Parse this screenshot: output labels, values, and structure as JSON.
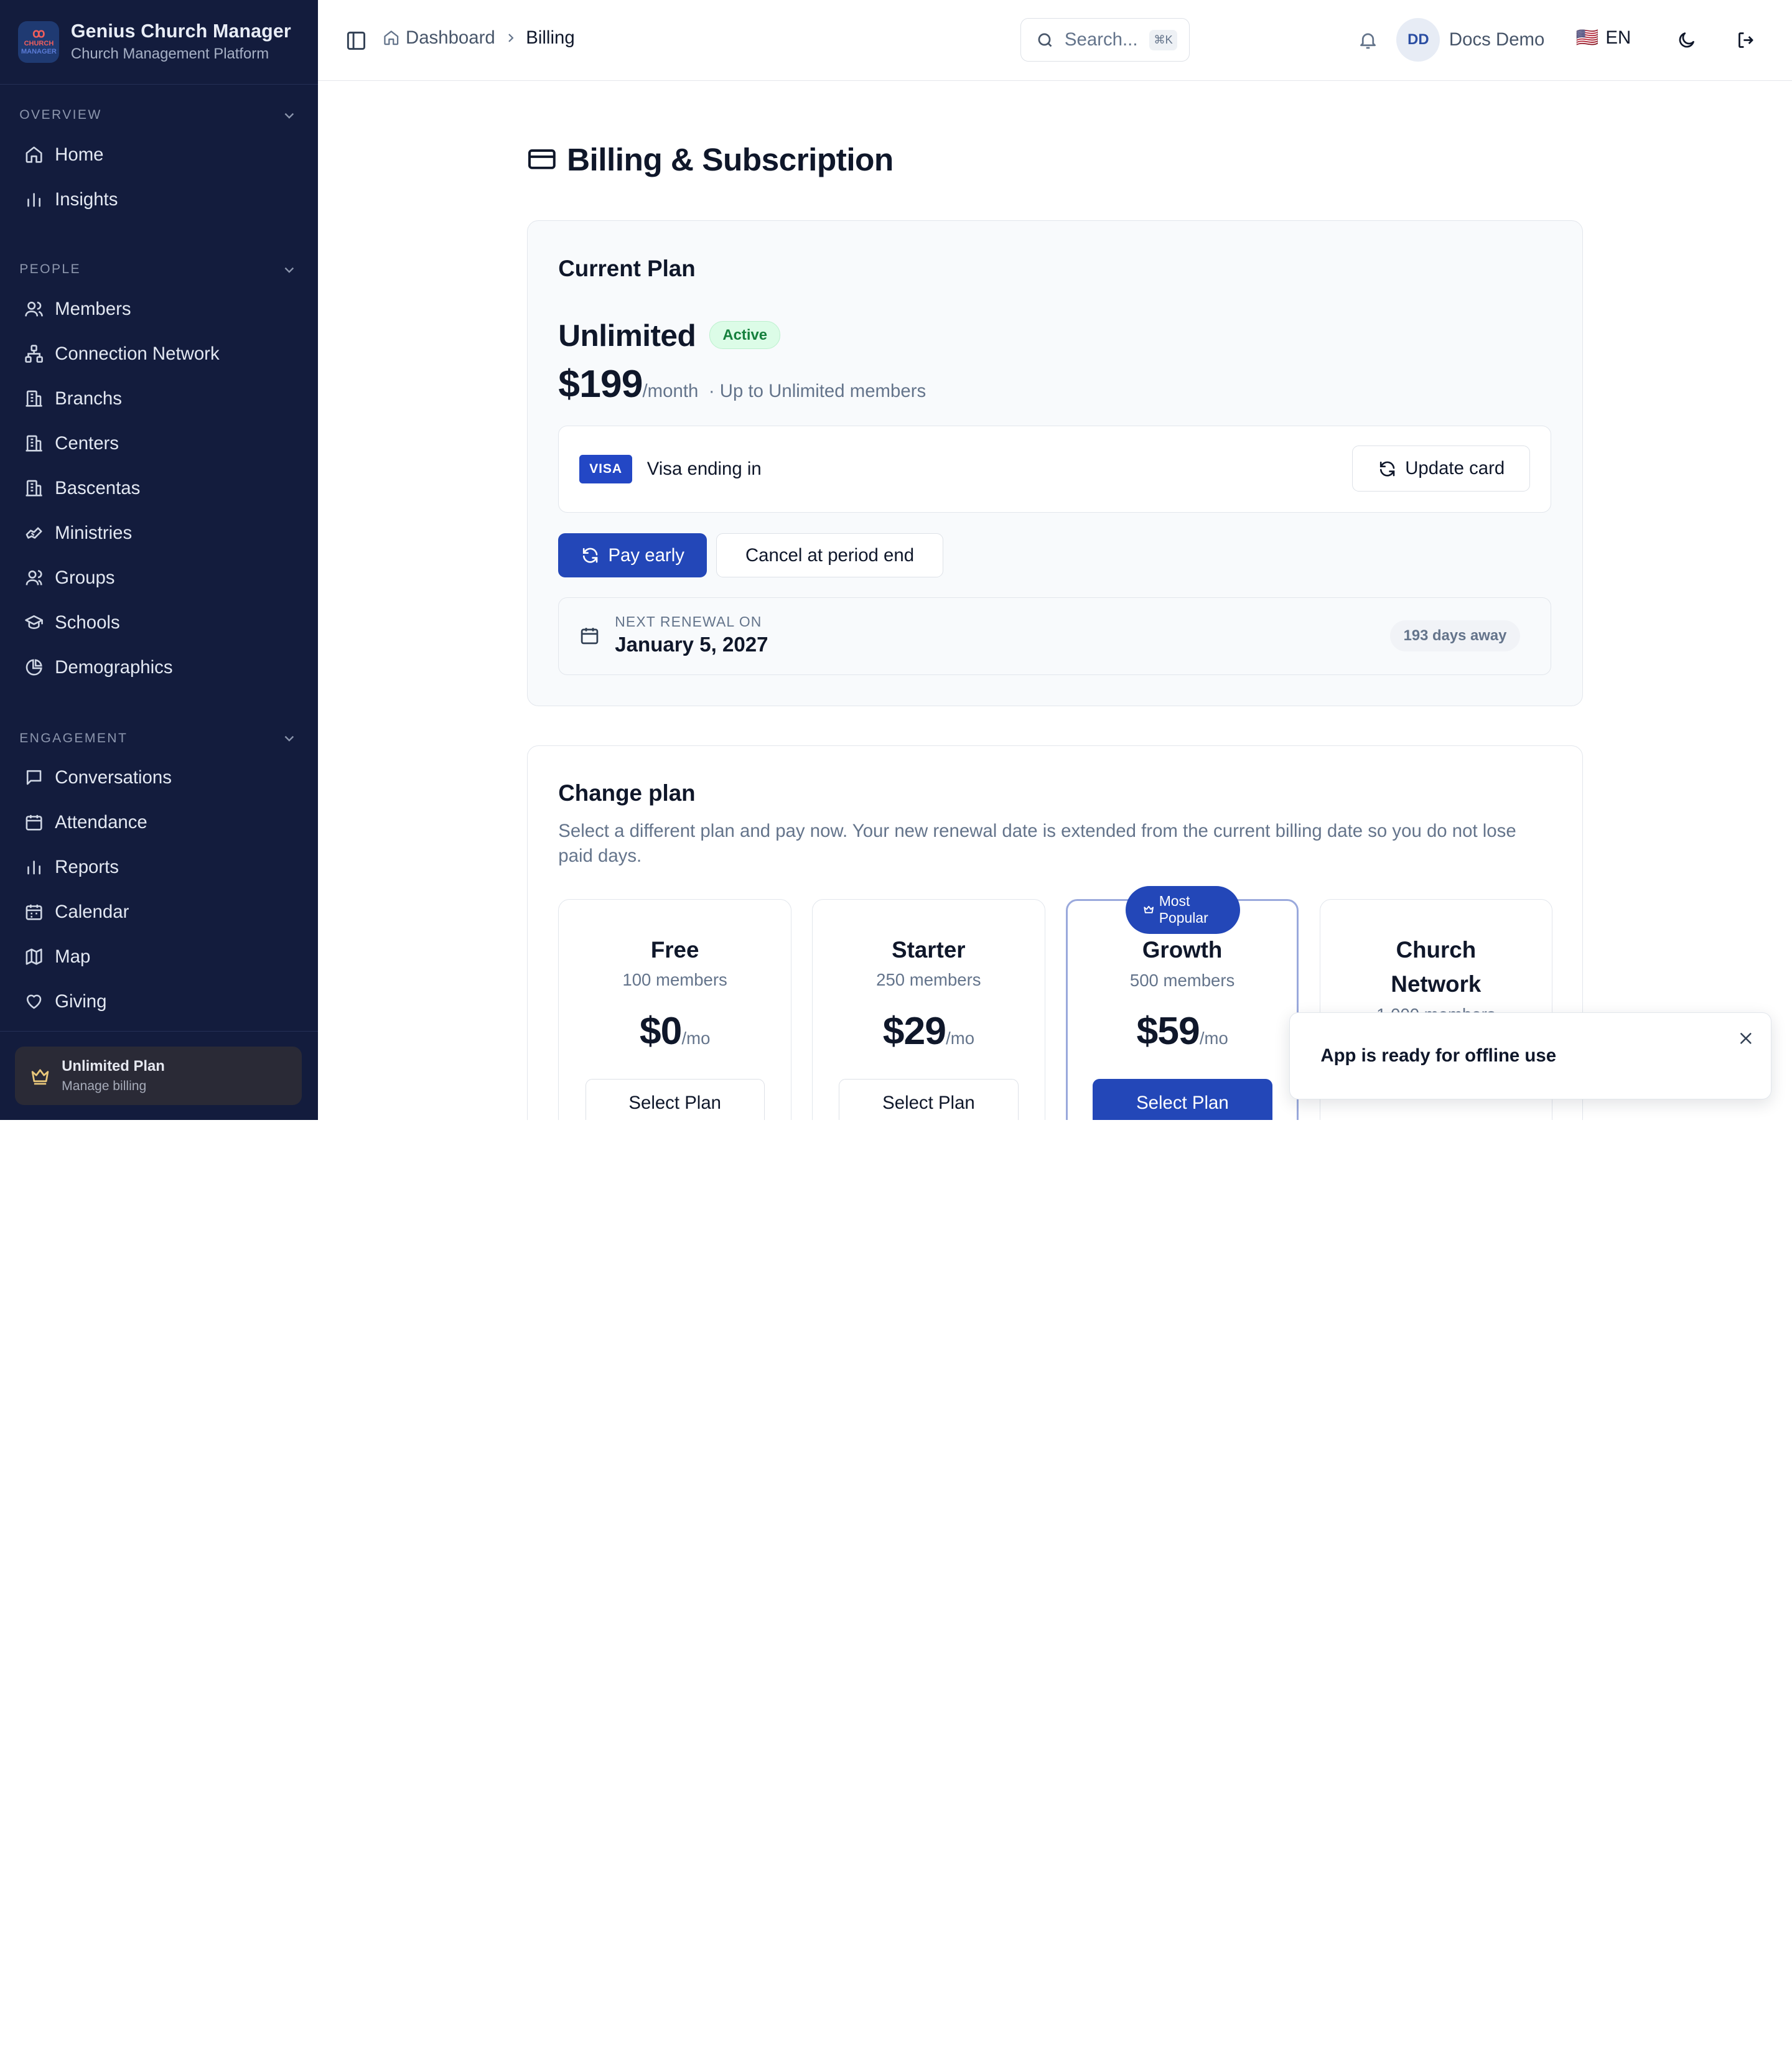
{
  "app": {
    "name": "Genius Church Manager",
    "subtitle": "Church Management Platform",
    "logo_text": "CHURCH MANAGER"
  },
  "sidebar": {
    "sections": [
      {
        "title": "OVERVIEW",
        "items": [
          {
            "label": "Home",
            "icon": "home-icon"
          },
          {
            "label": "Insights",
            "icon": "bar-chart-icon"
          }
        ]
      },
      {
        "title": "PEOPLE",
        "items": [
          {
            "label": "Members",
            "icon": "users-icon"
          },
          {
            "label": "Connection Network",
            "icon": "network-icon"
          },
          {
            "label": "Branchs",
            "icon": "building-icon"
          },
          {
            "label": "Centers",
            "icon": "building-icon"
          },
          {
            "label": "Bascentas",
            "icon": "building-icon"
          },
          {
            "label": "Ministries",
            "icon": "hand-heart-icon"
          },
          {
            "label": "Groups",
            "icon": "group-icon"
          },
          {
            "label": "Schools",
            "icon": "graduation-cap-icon"
          },
          {
            "label": "Demographics",
            "icon": "pie-chart-icon"
          }
        ]
      },
      {
        "title": "ENGAGEMENT",
        "items": [
          {
            "label": "Conversations",
            "icon": "message-icon"
          },
          {
            "label": "Attendance",
            "icon": "calendar-check-icon"
          },
          {
            "label": "Reports",
            "icon": "bar-chart-icon"
          },
          {
            "label": "Calendar",
            "icon": "calendar-icon"
          },
          {
            "label": "Map",
            "icon": "map-icon"
          },
          {
            "label": "Giving",
            "icon": "heart-icon"
          }
        ]
      }
    ],
    "plan_card": {
      "title": "Unlimited Plan",
      "subtitle": "Manage billing"
    }
  },
  "header": {
    "breadcrumb": {
      "root": "Dashboard",
      "current": "Billing"
    },
    "search_placeholder": "Search...",
    "search_shortcut": "⌘K",
    "user_initials": "DD",
    "user_name": "Docs Demo",
    "language_flag": "🇺🇸",
    "language": "EN"
  },
  "page": {
    "title": "Billing & Subscription"
  },
  "current_plan": {
    "heading": "Current Plan",
    "plan_name": "Unlimited",
    "status": "Active",
    "price": "$199",
    "period": "/month",
    "members_note": "· Up to Unlimited members",
    "card_brand": "VISA",
    "card_text": "Visa ending in",
    "update_card_label": "Update card",
    "pay_early_label": "Pay early",
    "cancel_label": "Cancel at period end",
    "renewal_label": "NEXT RENEWAL ON",
    "renewal_date": "January 5, 2027",
    "renewal_countdown": "193 days away"
  },
  "change_plan": {
    "heading": "Change plan",
    "description": "Select a different plan and pay now. Your new renewal date is extended from the current billing date so you do not lose paid days.",
    "popular_badge": "Most Popular",
    "plans": [
      {
        "name": "Free",
        "members": "100 members",
        "price": "$0",
        "period": "/mo",
        "button": "Select Plan"
      },
      {
        "name": "Starter",
        "members": "250 members",
        "price": "$29",
        "period": "/mo",
        "button": "Select Plan"
      },
      {
        "name": "Growth",
        "members": "500 members",
        "price": "$59",
        "period": "/mo",
        "button": "Select Plan",
        "featured": true
      },
      {
        "name": "Church Network",
        "members": "1,000 members"
      }
    ]
  },
  "toast": {
    "message": "App is ready for offline use"
  },
  "colors": {
    "sidebar_bg": "#131c3d",
    "primary": "#2347b8",
    "active_badge": "#15803d"
  }
}
